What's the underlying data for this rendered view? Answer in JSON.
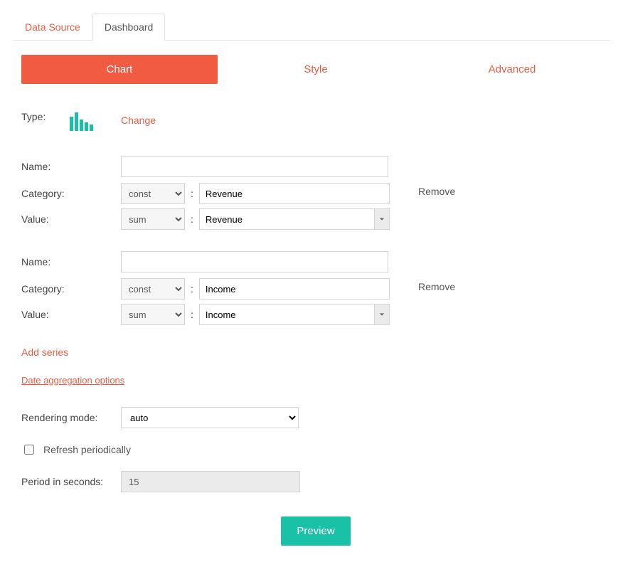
{
  "topTabs": {
    "dataSource": "Data Source",
    "dashboard": "Dashboard"
  },
  "subTabs": {
    "chart": "Chart",
    "style": "Style",
    "advanced": "Advanced"
  },
  "labels": {
    "type": "Type:",
    "change": "Change",
    "name": "Name:",
    "category": "Category:",
    "value": "Value:",
    "remove": "Remove",
    "addSeries": "Add series",
    "dateAgg": "Date aggregation options",
    "renderingMode": "Rendering mode:",
    "refresh": "Refresh periodically",
    "period": "Period in seconds:",
    "preview": "Preview"
  },
  "series": [
    {
      "name": "",
      "categoryFn": "const",
      "categoryField": "Revenue",
      "valueFn": "sum",
      "valueField": "Revenue"
    },
    {
      "name": "",
      "categoryFn": "const",
      "categoryField": "Income",
      "valueFn": "sum",
      "valueField": "Income"
    }
  ],
  "renderingMode": "auto",
  "refreshPeriodically": false,
  "periodSeconds": "15"
}
